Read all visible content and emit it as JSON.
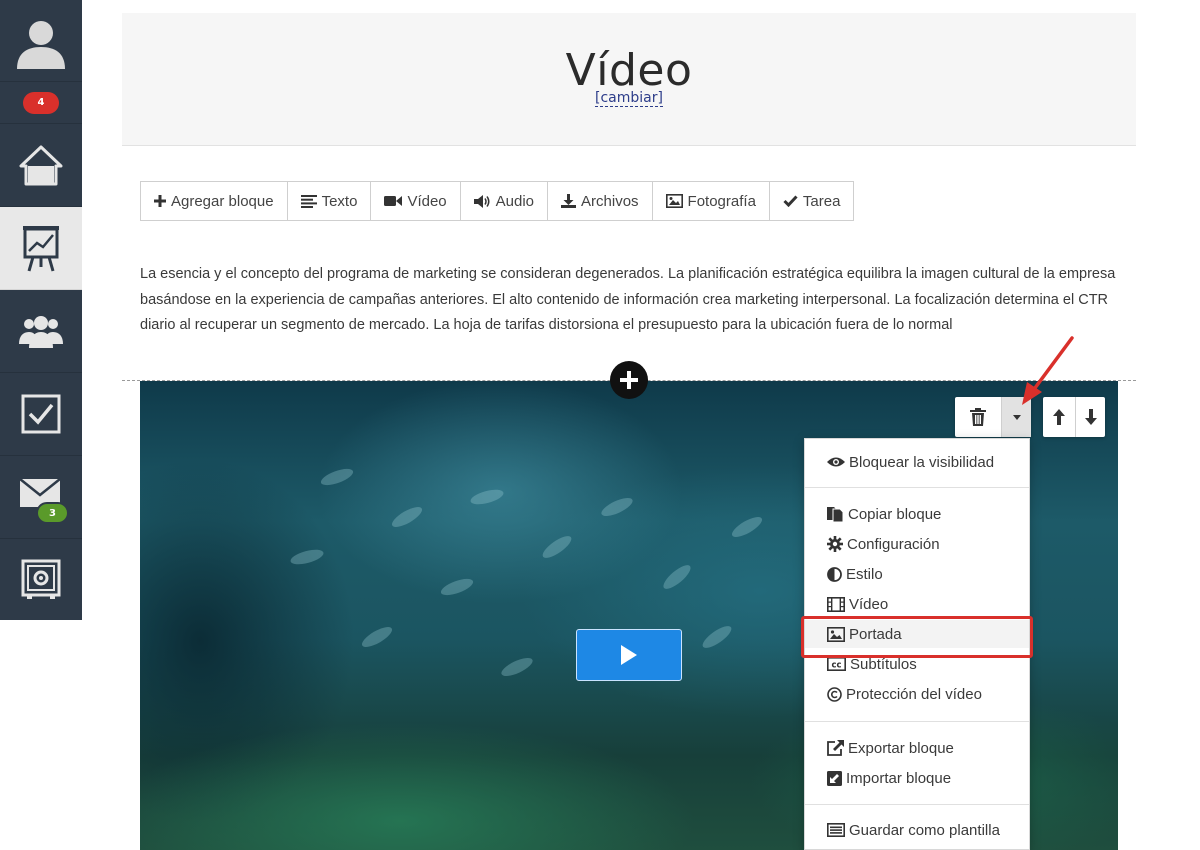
{
  "sidebar": {
    "notification_badge": "4",
    "mail_badge": "3",
    "items": [
      {
        "name": "avatar",
        "icon": "user-silhouette-icon"
      },
      {
        "name": "home",
        "icon": "home-icon"
      },
      {
        "name": "training",
        "icon": "presentation-chart-icon"
      },
      {
        "name": "users",
        "icon": "group-icon"
      },
      {
        "name": "tasks",
        "icon": "checkbox-icon"
      },
      {
        "name": "mail",
        "icon": "envelope-icon"
      },
      {
        "name": "settings",
        "icon": "safe-gear-icon"
      }
    ],
    "colors": {
      "rail": "#2e3a48",
      "active": "#e8e8e8",
      "badge_red": "#d9302b",
      "badge_green": "#5a9a2a"
    }
  },
  "header": {
    "title": "Vídeo",
    "change_link": "[cambiar]"
  },
  "toolbar": {
    "add_block": "Agregar bloque",
    "text": "Texto",
    "video": "Vídeo",
    "audio": "Audio",
    "files": "Archivos",
    "photo": "Fotografía",
    "task": "Tarea"
  },
  "content": {
    "paragraph": "La esencia y el concepto del programa de marketing se consideran degenerados. La planificación estratégica equilibra la imagen cultural de la empresa basándose en la experiencia de campañas anteriores. El alto contenido de información crea marketing interpersonal. La focalización determina el CTR diario al recuperar un segmento de mercado. La hoja de tarifas distorsiona el presupuesto para la ubicación fuera de lo normal"
  },
  "block_menu": {
    "visibility": "Bloquear la visibilidad",
    "copy": "Copiar bloque",
    "settings": "Configuración",
    "style": "Estilo",
    "video": "Vídeo",
    "cover": "Portada",
    "subtitles": "Subtítulos",
    "protection": "Protección del vídeo",
    "export": "Exportar bloque",
    "import": "Importar bloque",
    "save_template": "Guardar como plantilla",
    "highlighted_item": "Portada"
  },
  "colors": {
    "play_button": "#1e88e5",
    "highlight_border": "#d9302b",
    "link": "#2d3d8a"
  }
}
